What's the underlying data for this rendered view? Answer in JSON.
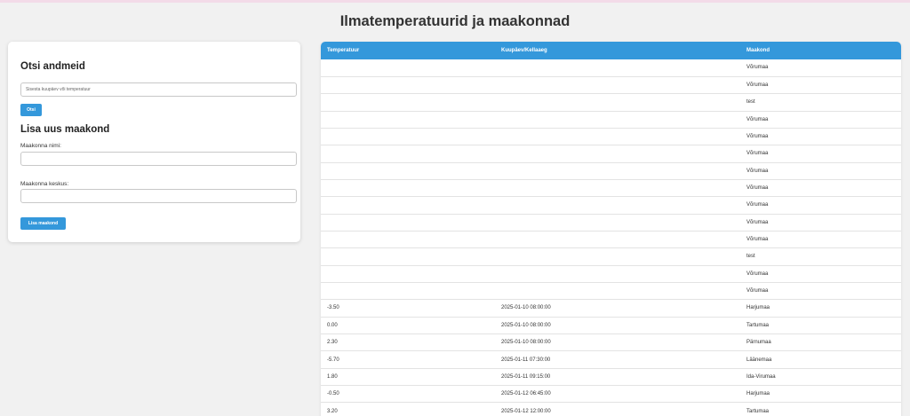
{
  "page": {
    "title": "Ilmatemperatuurid ja maakonnad"
  },
  "search": {
    "title": "Otsi andmeid",
    "placeholder": "Sisesta kuupäev või temperatuur",
    "button": "Otsi"
  },
  "add_county": {
    "title": "Lisa uus maakond",
    "name_label": "Maakonna nimi:",
    "center_label": "Maakonna keskus:",
    "button": "Lisa maakond"
  },
  "table": {
    "headers": [
      "Temperatuur",
      "Kuupäev/Kellaaeg",
      "Maakond"
    ],
    "rows": [
      [
        "",
        "",
        "Võrumaa"
      ],
      [
        "",
        "",
        "Võrumaa"
      ],
      [
        "",
        "",
        "test"
      ],
      [
        "",
        "",
        "Võrumaa"
      ],
      [
        "",
        "",
        "Võrumaa"
      ],
      [
        "",
        "",
        "Võrumaa"
      ],
      [
        "",
        "",
        "Võrumaa"
      ],
      [
        "",
        "",
        "Võrumaa"
      ],
      [
        "",
        "",
        "Võrumaa"
      ],
      [
        "",
        "",
        "Võrumaa"
      ],
      [
        "",
        "",
        "Võrumaa"
      ],
      [
        "",
        "",
        "test"
      ],
      [
        "",
        "",
        "Võrumaa"
      ],
      [
        "",
        "",
        "Võrumaa"
      ],
      [
        "-3.50",
        "2025-01-10 08:00:00",
        "Harjumaa"
      ],
      [
        "0.00",
        "2025-01-10 08:00:00",
        "Tartumaa"
      ],
      [
        "2.30",
        "2025-01-10 08:00:00",
        "Pärnumaa"
      ],
      [
        "-5.70",
        "2025-01-11 07:30:00",
        "Läänemaa"
      ],
      [
        "1.80",
        "2025-01-11 09:15:00",
        "Ida-Virumaa"
      ],
      [
        "-0.50",
        "2025-01-12 06:45:00",
        "Harjumaa"
      ],
      [
        "3.20",
        "2025-01-12 12:00:00",
        "Tartumaa"
      ]
    ]
  },
  "colors": {
    "accent": "#3498db",
    "background": "#f1f1f1",
    "text": "#333333"
  }
}
